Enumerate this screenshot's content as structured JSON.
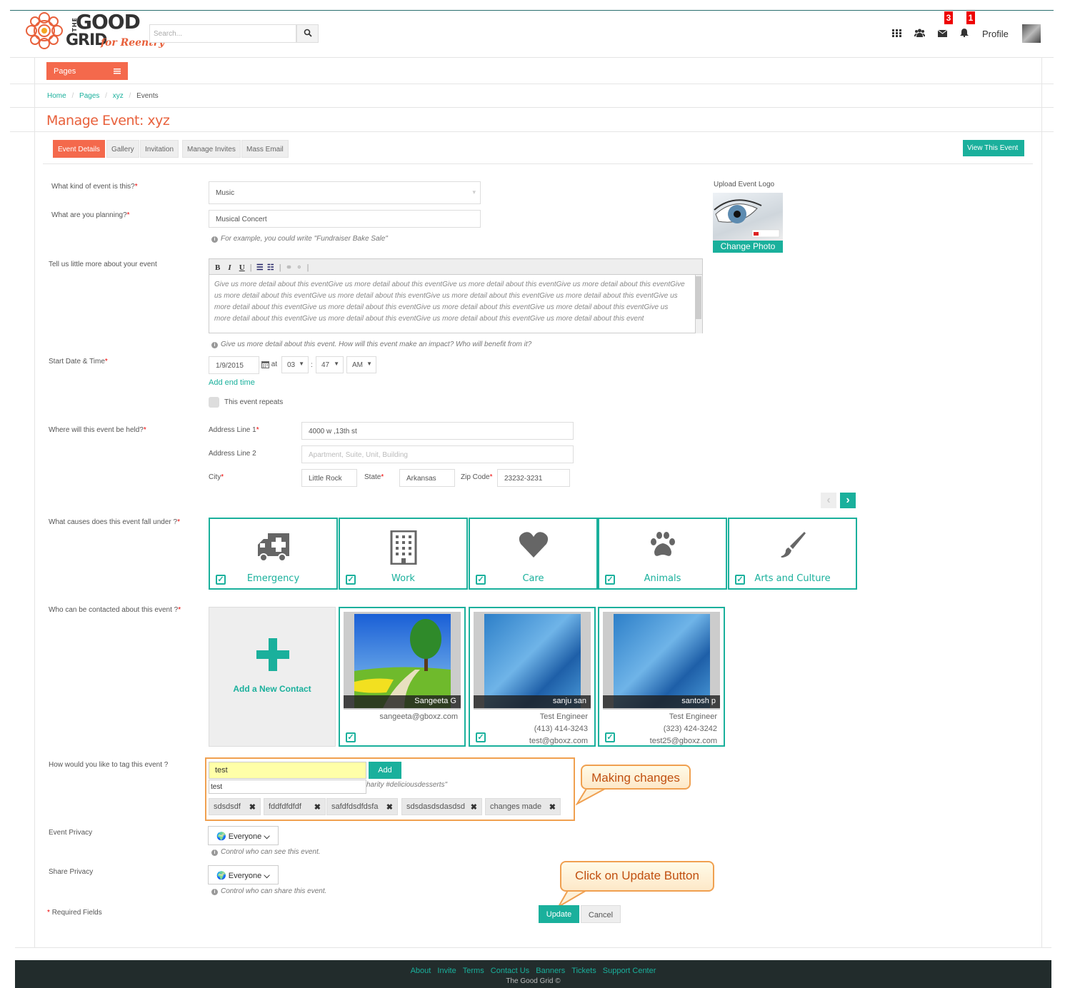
{
  "header": {
    "logo_top": "GOOD",
    "logo_bottom": "GRID",
    "logo_side": "THE",
    "logo_tagline": "for Reentry",
    "search_placeholder": "Search...",
    "messages_badge": "3",
    "notifications_badge": "1",
    "profile_label": "Profile"
  },
  "nav": {
    "pages_label": "Pages",
    "breadcrumbs": [
      "Home",
      "Pages",
      "xyz",
      "Events"
    ],
    "title": "Manage Event: xyz"
  },
  "tabs": [
    "Event Details",
    "Gallery",
    "Invitation",
    "Manage Invites",
    "Mass Email"
  ],
  "view_event_label": "View This Event",
  "form": {
    "kind_label": "What kind of event is this?",
    "kind_value": "Music",
    "planning_label": "What are you planning?",
    "planning_value": "Musical Concert",
    "planning_hint": "For example, you could write \"Fundraiser Bake Sale\"",
    "more_label": "Tell us little more about your event",
    "more_text": "Give us more detail about this eventGive us more detail about this eventGive us more detail about this eventGive us more detail about this eventGive us more detail about this eventGive us more detail about this eventGive us more detail about this eventGive us more detail about this eventGive us more detail about this eventGive us more detail about this eventGive us more detail about this eventGive us more detail about this eventGive us more detail about this eventGive us more detail about this eventGive us more detail about this eventGive us more detail about this event",
    "more_hint": "Give us more detail about this event. How will this event make an impact? Who will benefit from it?",
    "start_label": "Start Date & Time",
    "start_date": "1/9/2015",
    "at_label": "at",
    "hour": "03",
    "minute": "47",
    "ampm": "AM",
    "add_end_time": "Add end time",
    "repeats_label": "This event repeats",
    "where_label": "Where will this event be held?",
    "addr1_label": "Address Line 1",
    "addr1_value": "4000 w ,13th st",
    "addr2_label": "Address Line 2",
    "addr2_placeholder": "Apartment, Suite, Unit, Building",
    "city_label": "City",
    "city_value": "Little Rock",
    "state_label": "State",
    "state_value": "Arkansas",
    "zip_label": "Zip Code",
    "zip_value": "23232-3231",
    "causes_label": "What causes does this event fall under ?",
    "contacts_label": "Who can be contacted about this event ?",
    "tag_label": "How would you like to tag this event ?",
    "tag_input": "test",
    "tag_suggestion": "test",
    "tag_add": "Add",
    "tag_hint": "harity #deliciousdesserts\"",
    "privacy_label": "Event Privacy",
    "privacy_value": "Everyone",
    "privacy_hint": "Control who can see this event.",
    "share_label": "Share Privacy",
    "share_value": "Everyone",
    "share_hint": "Control who can share this event.",
    "required_note": "Required Fields",
    "update_label": "Update",
    "cancel_label": "Cancel"
  },
  "upload": {
    "label": "Upload Event Logo",
    "change_photo": "Change Photo"
  },
  "causes": [
    "Emergency",
    "Work",
    "Care",
    "Animals",
    "Arts and Culture"
  ],
  "contacts": {
    "add_label": "Add a New Contact",
    "people": [
      {
        "name": "Sangeeta G",
        "email": "sangeeta@gboxz.com"
      },
      {
        "name": "sanju san",
        "title": "Test Engineer",
        "phone": "(413) 414-3243",
        "email": "test@gboxz.com"
      },
      {
        "name": "santosh p",
        "title": "Test Engineer",
        "phone": "(323) 424-3242",
        "email": "test25@gboxz.com"
      }
    ]
  },
  "tags": [
    "sdsdsdf",
    "fddfdfdfdf",
    "safdfdsdfdsfa",
    "sdsdasdsdasdsd",
    "changes made"
  ],
  "callouts": {
    "making_changes": "Making changes",
    "click_update": "Click on Update Button"
  },
  "footer": {
    "links": [
      "About",
      "Invite",
      "Terms",
      "Contact Us",
      "Banners",
      "Tickets",
      "Support Center"
    ],
    "copyright": "The Good Grid ©"
  },
  "colors": {
    "accent": "#1ab09c",
    "brand": "#f4694c",
    "title": "#e8613c",
    "badge": "#ee0000"
  }
}
